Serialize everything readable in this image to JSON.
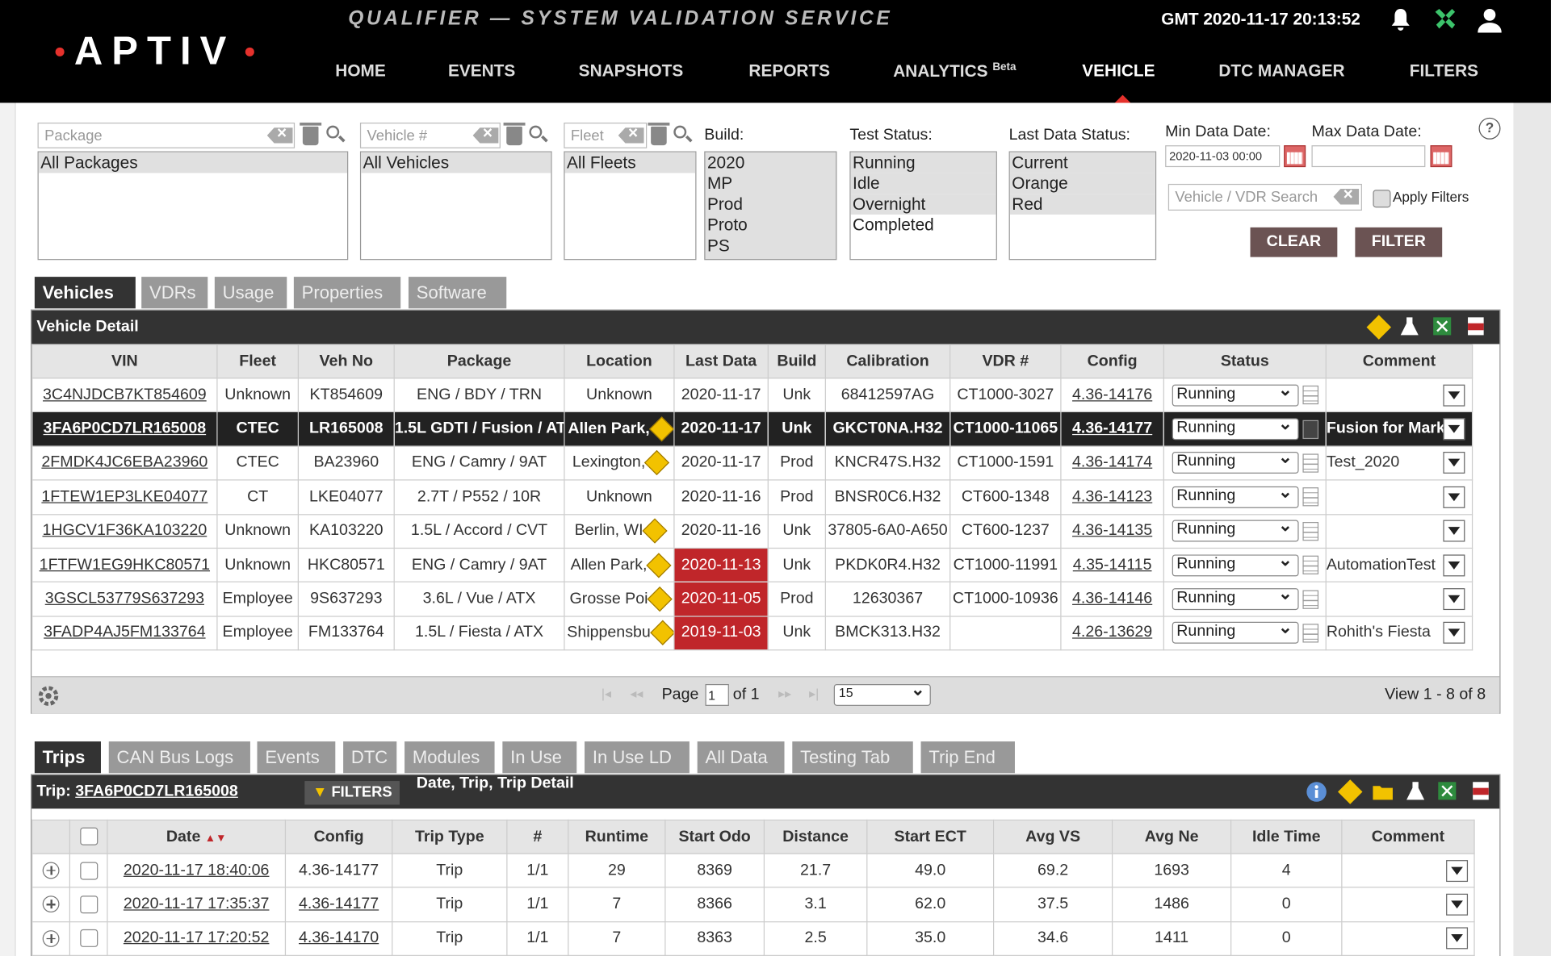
{
  "header": {
    "logo": "APTIV",
    "app_title": "QUALIFIER — SYSTEM VALIDATION SERVICE",
    "clock": "GMT 2020-11-17 20:13:52",
    "nav": [
      "HOME",
      "EVENTS",
      "SNAPSHOTS",
      "REPORTS",
      "ANALYTICS",
      "VEHICLE",
      "DTC MANAGER",
      "FILTERS"
    ],
    "analytics_badge": "Beta",
    "active_nav": "VEHICLE"
  },
  "filters": {
    "package_placeholder": "Package",
    "vehicle_placeholder": "Vehicle #",
    "fleet_placeholder": "Fleet",
    "package_options": [
      "All Packages"
    ],
    "vehicle_options": [
      "All Vehicles"
    ],
    "fleet_options": [
      "All Fleets"
    ],
    "build_label": "Build:",
    "build_options": [
      "2020",
      "MP",
      "Prod",
      "Proto",
      "PS"
    ],
    "test_status_label": "Test Status:",
    "test_status_options": [
      "Running",
      "Idle",
      "Overnight",
      "Completed"
    ],
    "last_data_status_label": "Last Data Status:",
    "last_data_status_options": [
      "Current",
      "Orange",
      "Red"
    ],
    "min_date_label": "Min Data Date:",
    "max_date_label": "Max Data Date:",
    "min_date_value": "2020-11-03 00:00",
    "max_date_value": "",
    "vdr_search_placeholder": "Vehicle / VDR Search",
    "apply_filters_label": "Apply Filters",
    "clear_label": "CLEAR",
    "filter_label": "FILTER",
    "help": "?"
  },
  "vehicle_tabs": [
    "Vehicles",
    "VDRs",
    "Usage",
    "Properties",
    "Software"
  ],
  "vehicle_panel": {
    "title": "Vehicle Detail",
    "columns": [
      "VIN",
      "Fleet",
      "Veh No",
      "Package",
      "Location",
      "Last Data",
      "Build",
      "Calibration",
      "VDR #",
      "Config",
      "Status",
      "Comment"
    ],
    "rows": [
      {
        "vin": "3C4NJDCB7KT854609",
        "fleet": "Unknown",
        "veh_no": "KT854609",
        "package": "ENG / BDY / TRN",
        "location": "Unknown",
        "last_data": "2020-11-17",
        "build": "Unk",
        "calibration": "68412597AG",
        "vdr": "CT1000-3027",
        "config": "4.36-14176",
        "status": "Running",
        "comment": ""
      },
      {
        "vin": "3FA6P0CD7LR165008",
        "fleet": "CTEC",
        "veh_no": "LR165008",
        "package": "1.5L GDTI / Fusion / AT",
        "location": "Allen Park,",
        "last_data": "2020-11-17",
        "build": "Unk",
        "calibration": "GKCT0NA.H32",
        "vdr": "CT1000-11065",
        "config": "4.36-14177",
        "status": "Running",
        "comment": "Fusion for Mark"
      },
      {
        "vin": "2FMDK4JC6EBA23960",
        "fleet": "CTEC",
        "veh_no": "BA23960",
        "package": "ENG / Camry / 9AT",
        "location": "Lexington,",
        "last_data": "2020-11-17",
        "build": "Prod",
        "calibration": "KNCR47S.H32",
        "vdr": "CT1000-1591",
        "config": "4.36-14174",
        "status": "Running",
        "comment": "Test_2020"
      },
      {
        "vin": "1FTEW1EP3LKE04077",
        "fleet": "CT",
        "veh_no": "LKE04077",
        "package": "2.7T / P552 / 10R",
        "location": "Unknown",
        "last_data": "2020-11-16",
        "build": "Prod",
        "calibration": "BNSR0C6.H32",
        "vdr": "CT600-1348",
        "config": "4.36-14123",
        "status": "Running",
        "comment": ""
      },
      {
        "vin": "1HGCV1F36KA103220",
        "fleet": "Unknown",
        "veh_no": "KA103220",
        "package": "1.5L / Accord / CVT",
        "location": "Berlin, WI",
        "last_data": "2020-11-16",
        "build": "Unk",
        "calibration": "37805-6A0-A650",
        "vdr": "CT600-1237",
        "config": "4.36-14135",
        "status": "Running",
        "comment": ""
      },
      {
        "vin": "1FTFW1EG9HKC80571",
        "fleet": "Unknown",
        "veh_no": "HKC80571",
        "package": "ENG / Camry / 9AT",
        "location": "Allen Park,",
        "last_data": "2020-11-13",
        "build": "Unk",
        "calibration": "PKDK0R4.H32",
        "vdr": "CT1000-11991",
        "config": "4.35-14115",
        "status": "Running",
        "comment": "AutomationTest"
      },
      {
        "vin": "3GSCL53779S637293",
        "fleet": "Employee",
        "veh_no": "9S637293",
        "package": "3.6L / Vue / ATX",
        "location": "Grosse Poi",
        "last_data": "2020-11-05",
        "build": "Prod",
        "calibration": "12630367",
        "vdr": "CT1000-10936",
        "config": "4.36-14146",
        "status": "Running",
        "comment": ""
      },
      {
        "vin": "3FADP4AJ5FM133764",
        "fleet": "Employee",
        "veh_no": "FM133764",
        "package": "1.5L / Fiesta / ATX",
        "location": "Shippensbu",
        "last_data": "2019-11-03",
        "build": "Unk",
        "calibration": "BMCK313.H32",
        "vdr": "",
        "config": "4.26-13629",
        "status": "Running",
        "comment": "Rohith's Fiesta"
      }
    ],
    "pager": {
      "page_label": "Page",
      "page": "1",
      "of_label": "of 1",
      "page_size": "15",
      "view_text": "View 1 - 8 of 8"
    }
  },
  "trip_tabs": [
    "Trips",
    "CAN Bus Logs",
    "Events",
    "DTC",
    "Modules",
    "In Use",
    "In Use LD",
    "All Data",
    "Testing Tab",
    "Trip End"
  ],
  "trip_panel": {
    "title_prefix": "Trip:",
    "title_vin": "3FA6P0CD7LR165008",
    "filters_label": "FILTERS",
    "filters_text": "Date, Trip, Trip Detail",
    "columns": [
      "Date",
      "Config",
      "Trip Type",
      "#",
      "Runtime",
      "Start Odo",
      "Distance",
      "Start ECT",
      "Avg VS",
      "Avg Ne",
      "Idle Time",
      "Comment"
    ],
    "rows": [
      {
        "date": "2020-11-17 18:40:06",
        "config": "4.36-14177",
        "type": "Trip",
        "num": "1/1",
        "runtime": "29",
        "odo": "8369",
        "distance": "21.7",
        "ect": "49.0",
        "vs": "69.2",
        "ne": "1693",
        "idle": "4"
      },
      {
        "date": "2020-11-17 17:35:37",
        "config": "4.36-14177",
        "type": "Trip",
        "num": "1/1",
        "runtime": "7",
        "odo": "8366",
        "distance": "3.1",
        "ect": "62.0",
        "vs": "37.5",
        "ne": "1486",
        "idle": "0"
      },
      {
        "date": "2020-11-17 17:20:52",
        "config": "4.36-14170",
        "type": "Trip",
        "num": "1/1",
        "runtime": "7",
        "odo": "8363",
        "distance": "2.5",
        "ect": "35.0",
        "vs": "34.6",
        "ne": "1411",
        "idle": "0"
      }
    ]
  }
}
